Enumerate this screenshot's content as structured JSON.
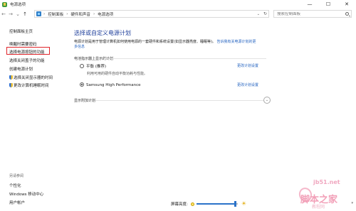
{
  "window": {
    "title": "电源选项",
    "controls": [
      "—",
      "☐",
      "✕"
    ]
  },
  "addressbar": {
    "back": "←",
    "forward": "→",
    "recent": "⌄",
    "up": "↑",
    "breadcrumbs": [
      "控制面板",
      "硬件和声音",
      "电源选项"
    ],
    "separator": "›",
    "dropdown": "⌄",
    "refresh": "↻",
    "search_placeholder": "搜索控制面板"
  },
  "sidebar": {
    "home": "控制面板主页",
    "items": [
      "唤醒时需要密码",
      "选择电源按钮的功能",
      "选择关闭盖子的功能",
      "创建电源计划",
      "选择关闭显示器的时间",
      "更改计算机睡眠时间"
    ],
    "see_also": "另请参阅",
    "bottom_items": [
      "个性化",
      "Windows 移动中心",
      "用户帐户"
    ]
  },
  "main": {
    "title": "选择或自定义电源计划",
    "description": "电源计划是用于管理计算机如何使用电源的一套硬件和系统设置(如显示器亮度、睡眠等)。",
    "description_link": "告诉我有关电源计划的更多信息",
    "section_header": "电池指示器上显示的计划",
    "plans": [
      {
        "name": "平衡 (推荐)",
        "desc": "利用可用的硬件自动平衡功耗与性能。",
        "link": "更改计划设置",
        "selected": false
      },
      {
        "name": "Samsung High Performance",
        "desc": "",
        "link": "更改计划设置",
        "selected": true
      }
    ],
    "additional": "显示附加计划",
    "expand": "⌄"
  },
  "brightness": {
    "label": "屏幕亮度:",
    "level_percent": 95,
    "bright_icon": "☀"
  },
  "scroll": {
    "down": "▾"
  },
  "watermark": {
    "url": "jb51.net",
    "text": "脚本之家",
    "sub": "教程网"
  }
}
